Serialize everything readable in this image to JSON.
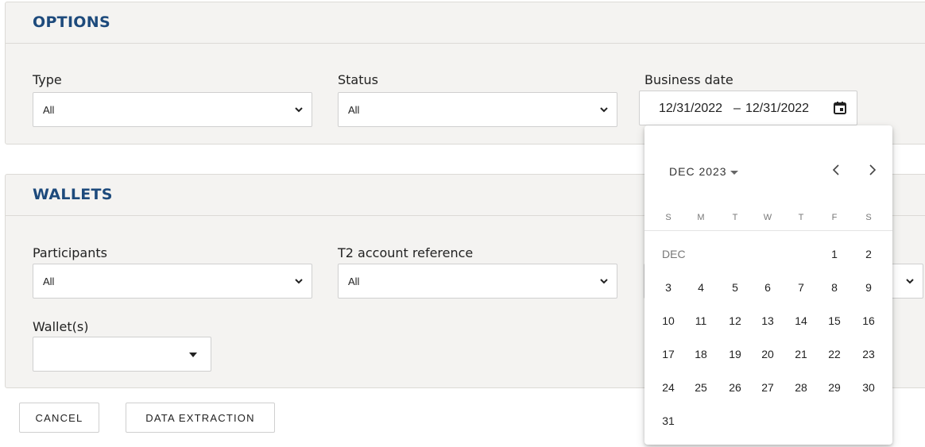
{
  "options": {
    "title": "OPTIONS",
    "type": {
      "label": "Type",
      "value": "All"
    },
    "status": {
      "label": "Status",
      "value": "All"
    },
    "business_date": {
      "label": "Business date",
      "start": "12/31/2022",
      "separator": "–",
      "end": "12/31/2022"
    }
  },
  "wallets": {
    "title": "WALLETS",
    "participants": {
      "label": "Participants",
      "value": "All"
    },
    "t2_account": {
      "label": "T2 account reference",
      "value": "All"
    },
    "wallets_field": {
      "label": "Wallet(s)",
      "value": ""
    }
  },
  "buttons": {
    "cancel": "CANCEL",
    "data_extraction": "DATA EXTRACTION"
  },
  "datepicker": {
    "period": "DEC 2023",
    "weekdays": [
      "S",
      "M",
      "T",
      "W",
      "T",
      "F",
      "S"
    ],
    "month_label": "DEC",
    "weeks": [
      [
        "",
        "",
        "",
        "",
        "",
        "1",
        "2"
      ],
      [
        "3",
        "4",
        "5",
        "6",
        "7",
        "8",
        "9"
      ],
      [
        "10",
        "11",
        "12",
        "13",
        "14",
        "15",
        "16"
      ],
      [
        "17",
        "18",
        "19",
        "20",
        "21",
        "22",
        "23"
      ],
      [
        "24",
        "25",
        "26",
        "27",
        "28",
        "29",
        "30"
      ],
      [
        "31",
        "",
        "",
        "",
        "",
        "",
        ""
      ]
    ]
  },
  "colors": {
    "title": "#1d4a7c",
    "panel_bg": "#f4f3f1"
  }
}
